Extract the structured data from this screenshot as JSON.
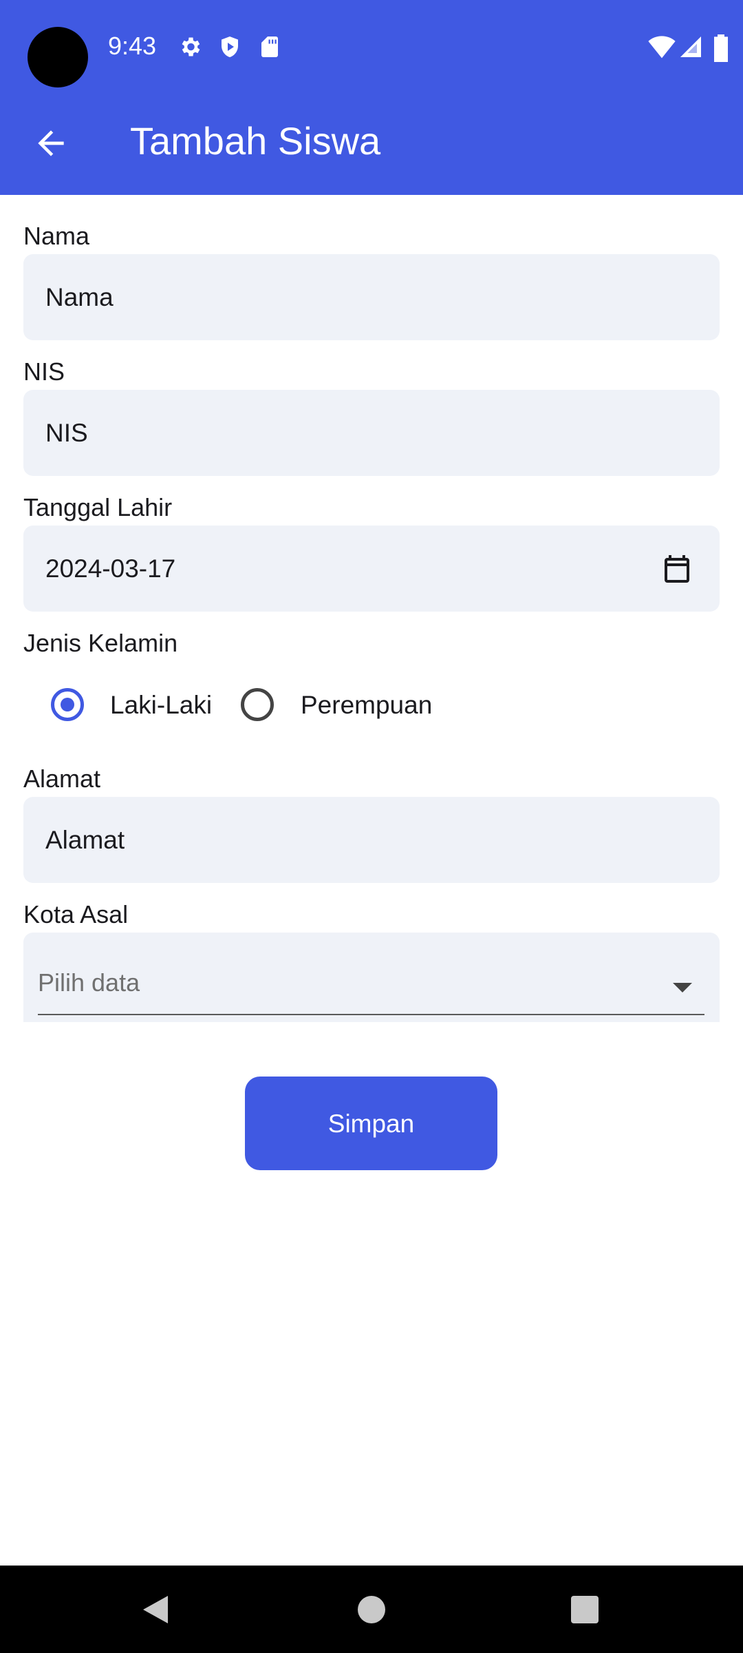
{
  "status_bar": {
    "time": "9:43",
    "icons": [
      "gear-icon",
      "shield-play-icon",
      "sd-card-icon",
      "wifi-icon",
      "signal-icon",
      "battery-icon"
    ]
  },
  "app_bar": {
    "title": "Tambah Siswa",
    "back_icon": "arrow-back-icon",
    "color": "#4059E2"
  },
  "form": {
    "nama": {
      "label": "Nama",
      "value": "Nama"
    },
    "nis": {
      "label": "NIS",
      "value": "NIS"
    },
    "tanggal_lahir": {
      "label": "Tanggal Lahir",
      "value": "2024-03-17",
      "icon": "calendar-icon"
    },
    "jenis_kelamin": {
      "label": "Jenis Kelamin",
      "options": [
        "Laki-Laki",
        "Perempuan"
      ],
      "selected": "Laki-Laki"
    },
    "alamat": {
      "label": "Alamat",
      "value": "Alamat"
    },
    "kota_asal": {
      "label": "Kota Asal",
      "placeholder": "Pilih data"
    }
  },
  "submit": {
    "label": "Simpan"
  },
  "nav_bar": {
    "icons": [
      "back-triangle-icon",
      "home-circle-icon",
      "recents-square-icon"
    ]
  }
}
